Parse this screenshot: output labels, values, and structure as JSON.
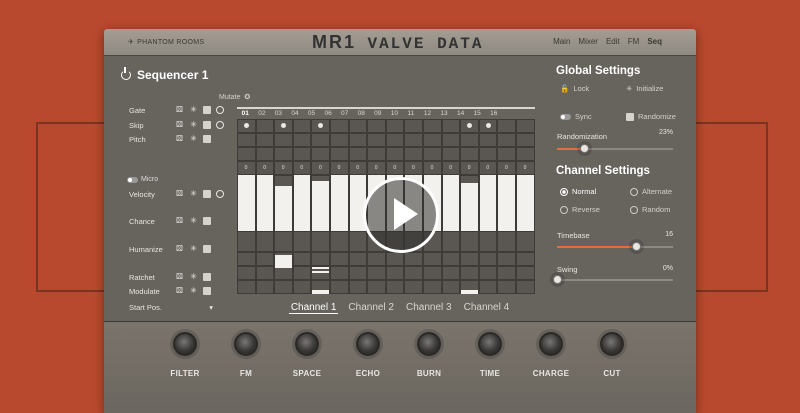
{
  "header": {
    "brand": "PHANTOM ROOMS",
    "product_prefix": "MR1",
    "product_name": "VALVE DATA"
  },
  "nav": [
    "Main",
    "Mixer",
    "Edit",
    "FM",
    "Seq"
  ],
  "sequencer": {
    "title": "Sequencer 1",
    "mutate_label": "Mutate",
    "lanes": [
      "Gate",
      "Skip",
      "Pitch",
      "Velocity",
      "Chance",
      "Humanize",
      "Ratchet",
      "Modulate"
    ],
    "micro_label": "Micro",
    "start_pos_label": "Start Pos.",
    "start_pos_arrow": "▾",
    "steps": [
      "01",
      "02",
      "03",
      "04",
      "05",
      "06",
      "07",
      "08",
      "09",
      "10",
      "11",
      "12",
      "13",
      "14",
      "15",
      "16"
    ],
    "current_step": 1,
    "gate_on_steps": [
      1,
      3,
      5,
      13,
      14
    ],
    "pitch_values": [
      "0",
      "0",
      "0",
      "0",
      "0",
      "0",
      "0",
      "0",
      "0",
      "0",
      "0",
      "0",
      "0",
      "0",
      "0",
      "0"
    ],
    "velocity_levels": [
      1.0,
      1.0,
      0.8,
      1.0,
      0.9,
      1.0,
      1.0,
      1.0,
      1.0,
      1.0,
      1.0,
      1.0,
      0.85,
      1.0,
      1.0,
      1.0
    ]
  },
  "global_settings": {
    "title": "Global Settings",
    "lock_label": "Lock",
    "initialize_label": "Initialize",
    "sync_label": "Sync",
    "randomize_label": "Randomize",
    "randomization_label": "Randomization",
    "randomization_value": "23%",
    "randomization_level": 0.23
  },
  "channel_settings": {
    "title": "Channel Settings",
    "modes": [
      "Normal",
      "Alternate",
      "Reverse",
      "Random"
    ],
    "selected_mode": "Normal",
    "timebase_label": "Timebase",
    "timebase_value": "16",
    "timebase_level": 0.68,
    "swing_label": "Swing",
    "swing_value": "0%",
    "swing_level": 0.0
  },
  "channels": [
    "Channel 1",
    "Channel 2",
    "Channel 3",
    "Channel 4"
  ],
  "active_channel": "Channel 1",
  "knobs": [
    "FILTER",
    "FM",
    "SPACE",
    "ECHO",
    "BURN",
    "TIME",
    "CHARGE",
    "CUT"
  ],
  "colors": {
    "background": "#b8492e",
    "accent": "#e2703d",
    "panel": "#67635d"
  }
}
